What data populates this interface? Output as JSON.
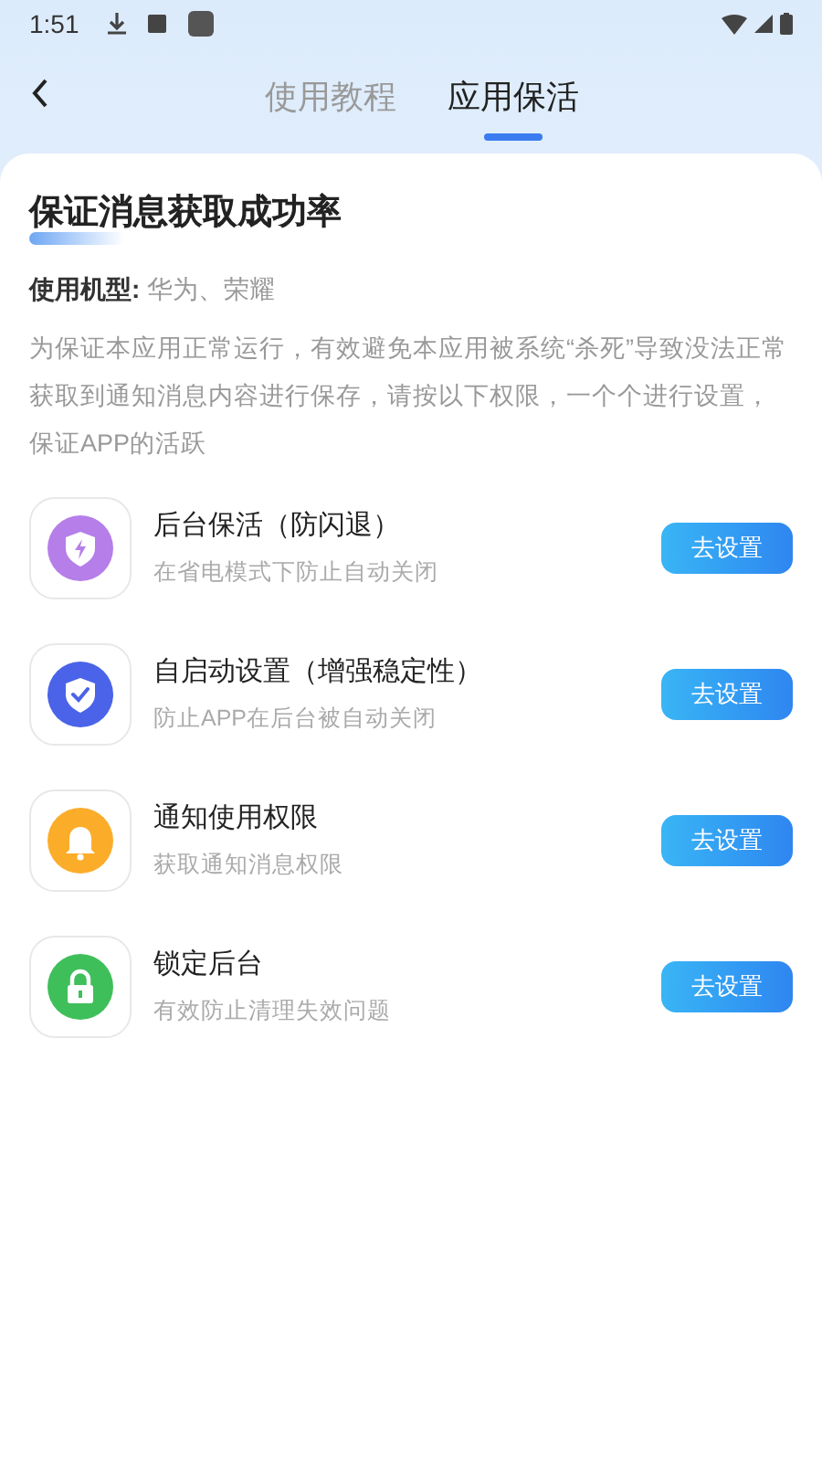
{
  "status_bar": {
    "time": "1:51"
  },
  "tabs": [
    {
      "label": "使用教程",
      "selected": false
    },
    {
      "label": "应用保活",
      "selected": true
    }
  ],
  "card": {
    "title": "保证消息获取成功率",
    "model_label": "使用机型:",
    "model_value": "华为、荣耀",
    "description": "为保证本应用正常运行，有效避免本应用被系统“杀死”导致没法正常获取到通知消息内容进行保存，请按以下权限，一个个进行设置，保证APP的活跃"
  },
  "permissions": [
    {
      "kind": "shield-bolt",
      "color": "#b57ee8",
      "title": "后台保活（防闪退）",
      "subtitle": "在省电模式下防止自动关闭",
      "button": "去设置"
    },
    {
      "kind": "shield-check",
      "color": "#4a63e8",
      "title": "自启动设置（增强稳定性）",
      "subtitle": "防止APP在后台被自动关闭",
      "button": "去设置"
    },
    {
      "kind": "bell",
      "color": "#fbad2a",
      "title": "通知使用权限",
      "subtitle": "获取通知消息权限",
      "button": "去设置"
    },
    {
      "kind": "lock",
      "color": "#3fbf5a",
      "title": "锁定后台",
      "subtitle": "有效防止清理失效问题",
      "button": "去设置"
    }
  ]
}
